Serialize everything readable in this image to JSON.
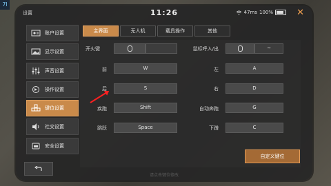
{
  "corner_badge": "7l",
  "header": {
    "title": "设置",
    "clock": "11:26",
    "ping": "47ms",
    "battery": "100%",
    "close_icon": "close-x"
  },
  "sidebar": {
    "items": [
      {
        "label": "账户设置",
        "icon": "account-card-icon",
        "active": false
      },
      {
        "label": "显示设置",
        "icon": "image-icon",
        "active": false
      },
      {
        "label": "声音设置",
        "icon": "sliders-icon",
        "active": false
      },
      {
        "label": "操作设置",
        "icon": "gesture-icon",
        "active": false
      },
      {
        "label": "键位设置",
        "icon": "keyboard-icon",
        "active": true
      },
      {
        "label": "社交设置",
        "icon": "speaker-icon",
        "active": false
      },
      {
        "label": "安全设置",
        "icon": "shield-icon",
        "active": false
      }
    ]
  },
  "tabs": [
    {
      "label": "主界面",
      "active": true
    },
    {
      "label": "无人机",
      "active": false
    },
    {
      "label": "载具操作",
      "active": false
    },
    {
      "label": "其他",
      "active": false
    }
  ],
  "bindings": {
    "fire": {
      "label": "开火键"
    },
    "mouse_toggle": {
      "label": "鼠标呼入/出",
      "value": "~"
    },
    "forward": {
      "label": "前",
      "value": "W"
    },
    "left": {
      "label": "左",
      "value": "A"
    },
    "back": {
      "label": "后",
      "value": "S"
    },
    "right": {
      "label": "右",
      "value": "D"
    },
    "sprint": {
      "label": "疾跑",
      "value": "Shift"
    },
    "auto_run": {
      "label": "自动奔跑",
      "value": "G"
    },
    "jump": {
      "label": "跳跃",
      "value": "Space"
    },
    "crouch": {
      "label": "下蹲",
      "value": "C"
    }
  },
  "custom_button": "自定义键位",
  "footer_note": "请点击键位修改"
}
